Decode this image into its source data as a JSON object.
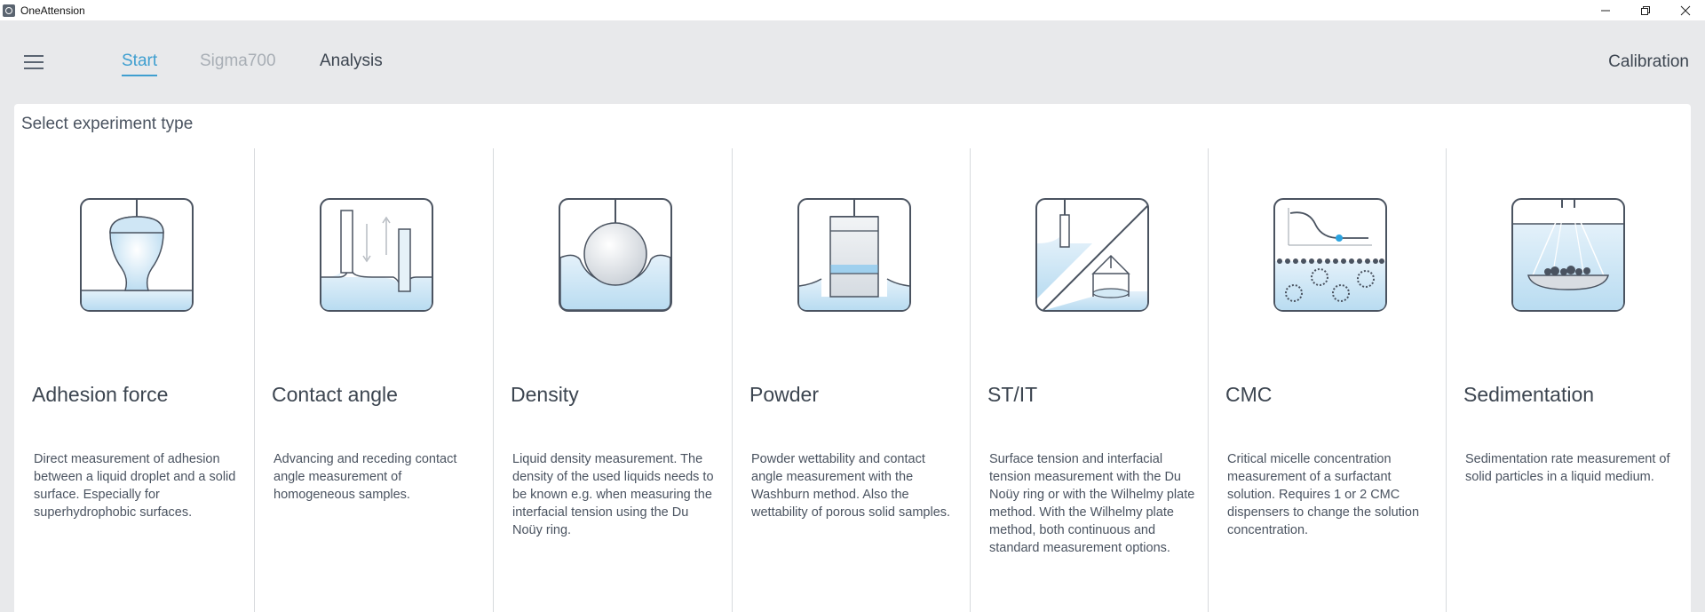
{
  "window": {
    "title": "OneAttension"
  },
  "nav": {
    "tabs": [
      {
        "label": "Start",
        "state": "active"
      },
      {
        "label": "Sigma700",
        "state": "disabled"
      },
      {
        "label": "Analysis",
        "state": "normal"
      }
    ],
    "calibration": "Calibration"
  },
  "main": {
    "title": "Select experiment type",
    "experiments": [
      {
        "icon": "adhesion-force-icon",
        "title": "Adhesion force",
        "description": "Direct measurement of adhesion between a liquid droplet and a solid surface. Especially for superhydrophobic surfaces."
      },
      {
        "icon": "contact-angle-icon",
        "title": "Contact angle",
        "description": "Advancing and receding contact angle measurement of homogeneous samples."
      },
      {
        "icon": "density-icon",
        "title": "Density",
        "description": "Liquid density measurement. The density of the used liquids needs to be known e.g. when measuring the interfacial tension using the Du Noüy ring."
      },
      {
        "icon": "powder-icon",
        "title": "Powder",
        "description": "Powder wettability and contact angle measurement with the Washburn method. Also the wettability of porous solid samples."
      },
      {
        "icon": "st-it-icon",
        "title": "ST/IT",
        "description": "Surface tension and interfacial tension measurement with the Du Noüy ring or with the Wilhelmy plate method. With the Wilhelmy plate method, both continuous and standard measurement options."
      },
      {
        "icon": "cmc-icon",
        "title": "CMC",
        "description": "Critical micelle concentration measurement of a surfactant solution. Requires 1 or 2 CMC dispensers to change the solution concentration."
      },
      {
        "icon": "sedimentation-icon",
        "title": "Sedimentation",
        "description": "Sedimentation rate measurement of solid particles in a liquid medium."
      }
    ]
  },
  "colors": {
    "accent": "#3f9fd0",
    "liquid": "#cfe6f5",
    "outline": "#4a5360"
  }
}
